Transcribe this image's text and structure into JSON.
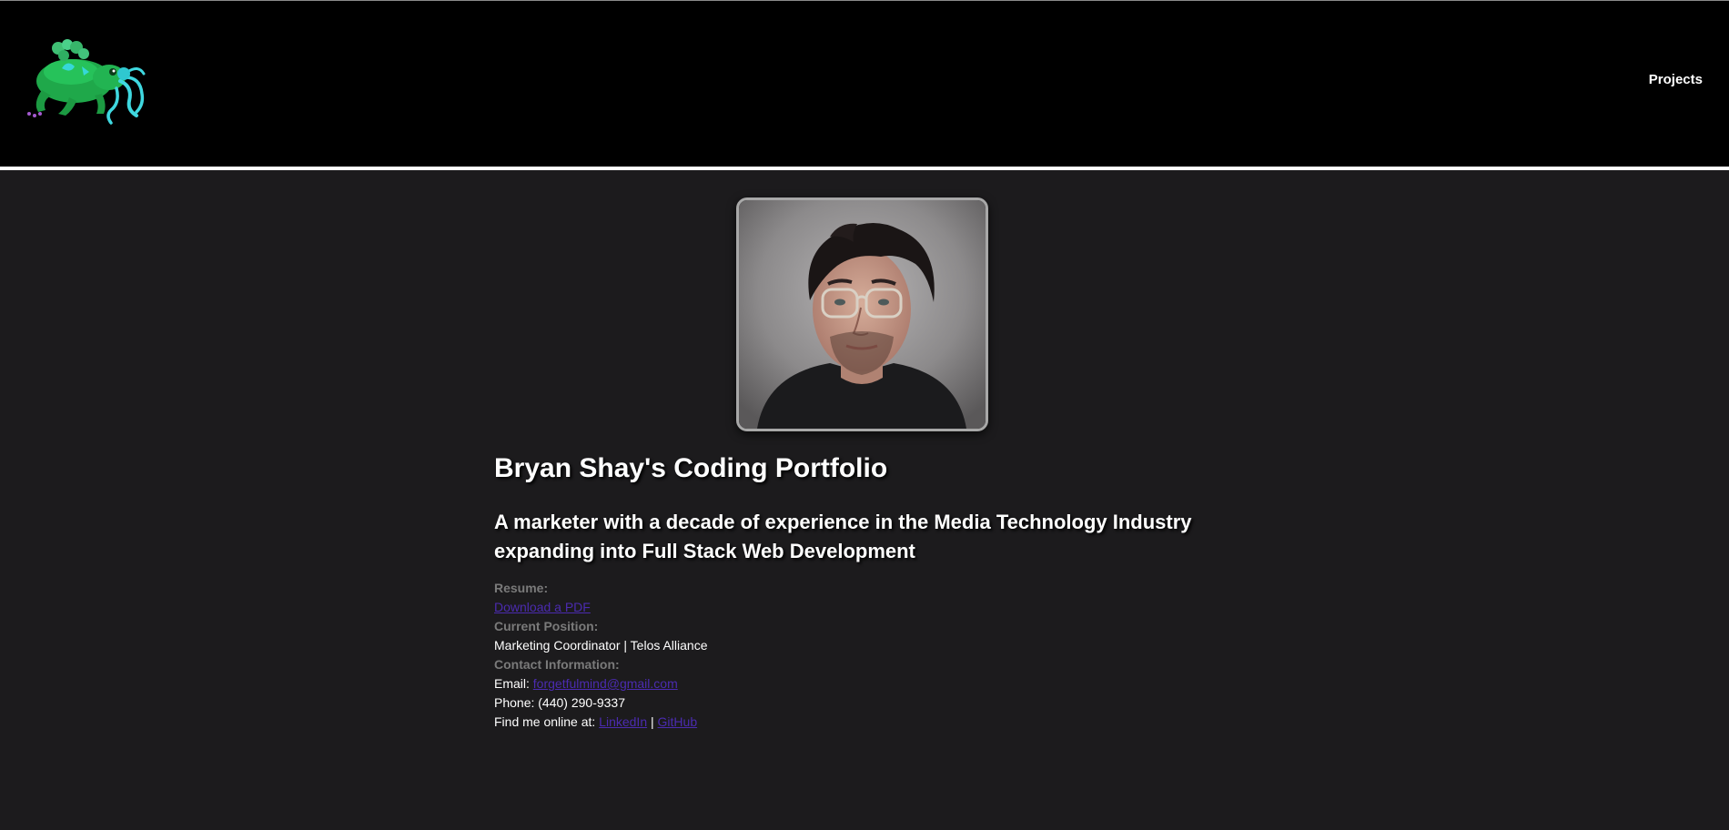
{
  "header": {
    "logo_name": "frog-octopus-logo",
    "nav": {
      "projects_label": "Projects"
    }
  },
  "profile": {
    "photo_alt": "Portrait of Bryan Shay"
  },
  "main": {
    "title": "Bryan Shay's Coding Portfolio",
    "subtitle": "A marketer with a decade of experience in the Media Technology Industry expanding into Full Stack Web Development",
    "resume_label": "Resume:",
    "resume_link": "Download a PDF",
    "position_label": "Current Position:",
    "position_value": "Marketing Coordinator | Telos Alliance",
    "contact_label": "Contact Information:",
    "email_prefix": "Email: ",
    "email_link": "forgetfulmind@gmail.com",
    "phone": "Phone: (440) 290-9337",
    "online_prefix": "Find me online at: ",
    "linkedin_link": "LinkedIn",
    "separator": " | ",
    "github_link": "GitHub"
  },
  "colors": {
    "page_background": "#1c1b1d",
    "header_background": "#000000",
    "label_gray": "#7a7a7a",
    "link_purple": "#4b2bb0"
  }
}
